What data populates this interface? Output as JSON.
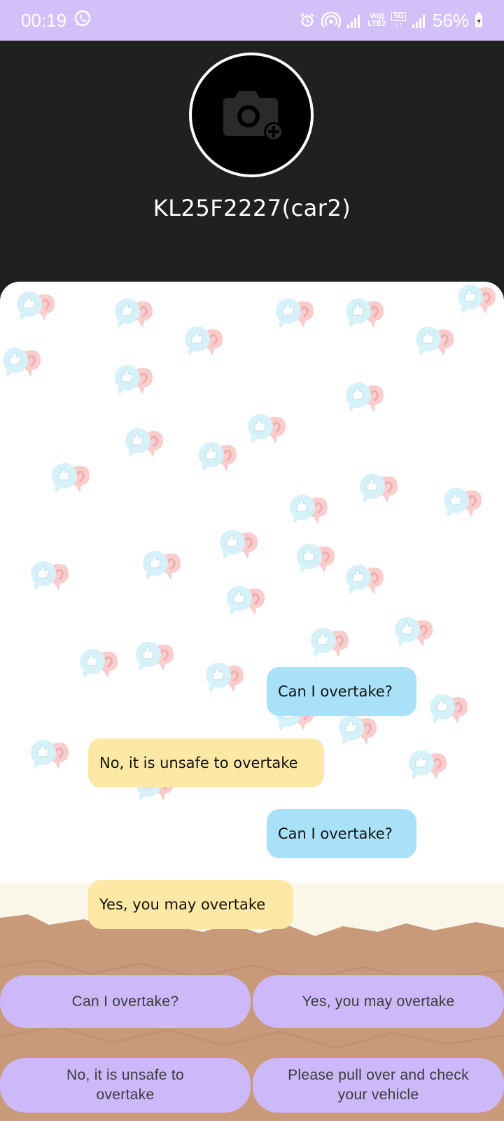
{
  "status_bar": {
    "time": "00:19",
    "battery": "56%",
    "network_label_1": "Vo))",
    "network_label_2": "LTE2",
    "network_label_3": "5G"
  },
  "header": {
    "title": "KL25F2227(car2)",
    "avatar_icon": "add-photo-camera-icon"
  },
  "messages": [
    {
      "type": "sent",
      "text": "Can I overtake?"
    },
    {
      "type": "received",
      "text": "No, it is unsafe to overtake"
    },
    {
      "type": "sent",
      "text": "Can I overtake?"
    },
    {
      "type": "received",
      "text": "Yes, you may overtake"
    }
  ],
  "quick_replies": [
    {
      "label": "Can I overtake?"
    },
    {
      "label": "Yes, you may overtake"
    },
    {
      "label": "No, it is unsafe to overtake"
    },
    {
      "label": "Please pull over and check your vehicle"
    }
  ],
  "colors": {
    "status_bar": "#d4c0f9",
    "header_bg": "#1f2121",
    "sent_bubble": "#a9e2f8",
    "received_bubble": "#fde8a6",
    "quick_reply": "#cdb8fa"
  }
}
